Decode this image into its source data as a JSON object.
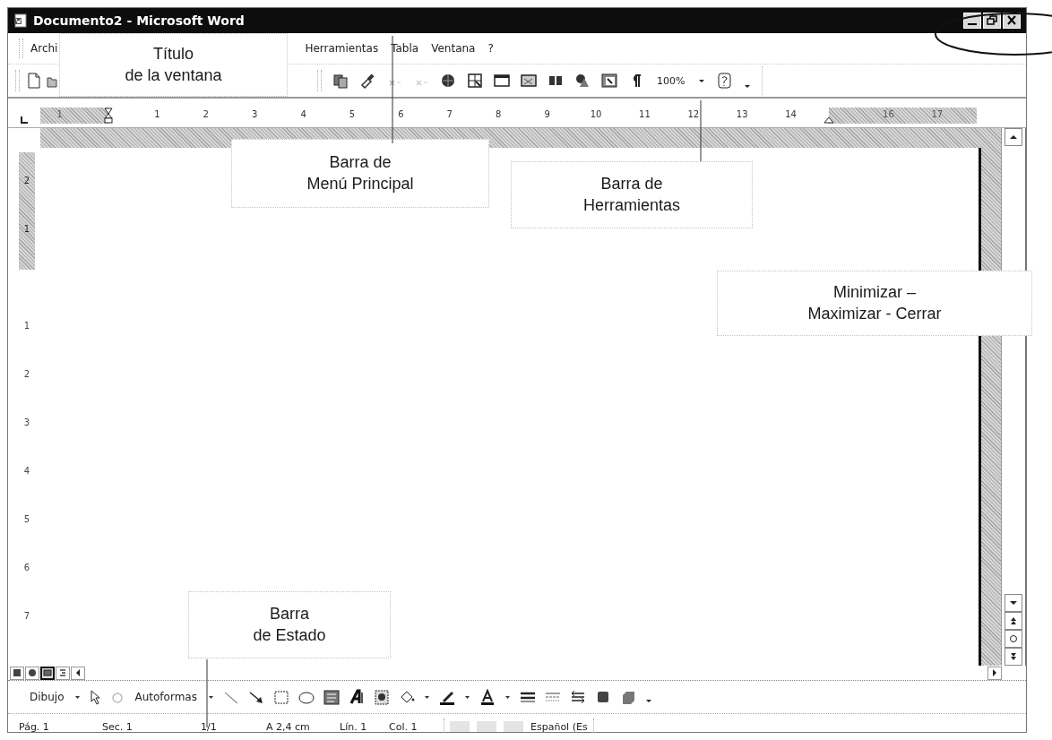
{
  "window": {
    "title": "Documento2 - Microsoft Word"
  },
  "menu": [
    {
      "label": "Archi"
    },
    {
      "label": "Herramientas"
    },
    {
      "label": "Tabla"
    },
    {
      "label": "Ventana"
    },
    {
      "label": "?"
    }
  ],
  "toolbar": {
    "zoom": "100%"
  },
  "ruler": {
    "marks": [
      {
        "label": "1",
        "margin": true
      },
      {
        "label": "1",
        "margin": false
      },
      {
        "label": "2",
        "margin": false
      },
      {
        "label": "3",
        "margin": false
      },
      {
        "label": "4",
        "margin": false
      },
      {
        "label": "5",
        "margin": false
      },
      {
        "label": "6",
        "margin": false
      },
      {
        "label": "7",
        "margin": false
      },
      {
        "label": "8",
        "margin": false
      },
      {
        "label": "9",
        "margin": false
      },
      {
        "label": "10",
        "margin": false
      },
      {
        "label": "11",
        "margin": false
      },
      {
        "label": "12",
        "margin": false
      },
      {
        "label": "13",
        "margin": false
      },
      {
        "label": "14",
        "margin": false
      },
      {
        "label": "16",
        "margin": true
      },
      {
        "label": "17",
        "margin": true
      }
    ]
  },
  "vertical_ruler": {
    "marks": [
      {
        "label": "2",
        "margin": true
      },
      {
        "label": "1",
        "margin": true
      },
      {
        "label": "1",
        "margin": false
      },
      {
        "label": "2",
        "margin": false
      },
      {
        "label": "3",
        "margin": false
      },
      {
        "label": "4",
        "margin": false
      },
      {
        "label": "5",
        "margin": false
      },
      {
        "label": "6",
        "margin": false
      },
      {
        "label": "7",
        "margin": false
      }
    ]
  },
  "views": [
    {
      "kind": "normal",
      "selected": false
    },
    {
      "kind": "web",
      "selected": false
    },
    {
      "kind": "print",
      "selected": true
    },
    {
      "kind": "outline",
      "selected": false
    }
  ],
  "drawing_toolbar": {
    "draw_menu": "Dibujo",
    "autoshapes_menu": "Autoformas"
  },
  "status_bar": [
    {
      "text": "Pág. 1"
    },
    {
      "text": "Sec. 1"
    },
    {
      "text": "1/1"
    },
    {
      "text": "A 2,4 cm"
    },
    {
      "text": "Lín. 1"
    },
    {
      "text": "Col. 1"
    },
    {
      "text": "Español (Es"
    }
  ],
  "annotations": [
    {
      "kind": "label",
      "text": "Título\nde la ventana"
    },
    {
      "kind": "label",
      "text": "Barra de\nMenú Principal"
    },
    {
      "kind": "label",
      "text": "Barra de\nHerramientas"
    },
    {
      "kind": "label",
      "text": "Minimizar –\nMaximizar - Cerrar"
    },
    {
      "kind": "label",
      "text": "Barra\nde Estado"
    },
    {
      "kind": "ellipse"
    },
    {
      "kind": "leader"
    },
    {
      "kind": "leader"
    },
    {
      "kind": "leader"
    }
  ]
}
